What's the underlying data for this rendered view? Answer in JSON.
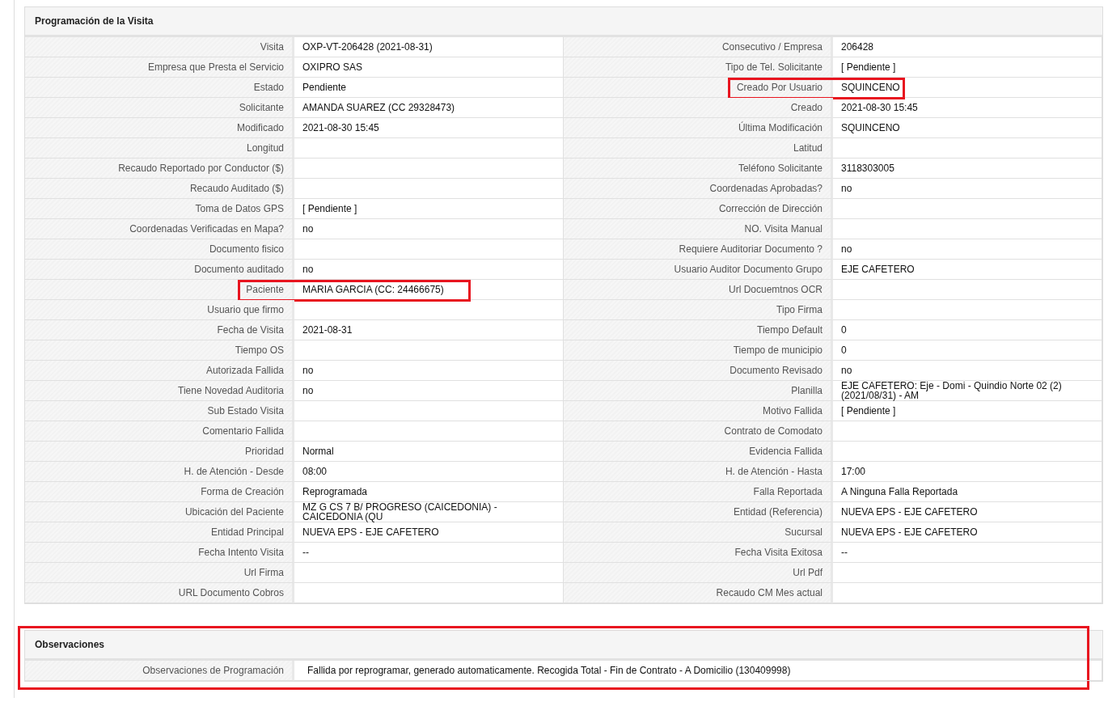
{
  "visit_panel": {
    "title": "Programación de la Visita",
    "rows": [
      {
        "left": {
          "label": "Visita",
          "value": "OXP-VT-206428 (2021-08-31)",
          "highlighted": false
        },
        "right": {
          "label": "Consecutivo / Empresa",
          "value": "206428",
          "highlighted": false
        }
      },
      {
        "left": {
          "label": "Empresa que Presta el Servicio",
          "value": "OXIPRO SAS",
          "highlighted": false
        },
        "right": {
          "label": "Tipo de Tel. Solicitante",
          "value": "[ Pendiente ]",
          "highlighted": false
        }
      },
      {
        "left": {
          "label": "Estado",
          "value": "Pendiente",
          "highlighted": false
        },
        "right": {
          "label": "Creado Por Usuario",
          "value": "SQUINCENO",
          "highlighted": true
        }
      },
      {
        "left": {
          "label": "Solicitante",
          "value": "AMANDA SUAREZ (CC 29328473)",
          "highlighted": false
        },
        "right": {
          "label": "Creado",
          "value": "2021-08-30 15:45",
          "highlighted": false
        }
      },
      {
        "left": {
          "label": "Modificado",
          "value": "2021-08-30 15:45",
          "highlighted": false
        },
        "right": {
          "label": "Última Modificación",
          "value": "SQUINCENO",
          "highlighted": false
        }
      },
      {
        "left": {
          "label": "Longitud",
          "highlighted": false
        },
        "right": {
          "label": "Latitud",
          "highlighted": false
        }
      },
      {
        "left": {
          "label": "Recaudo Reportado por Conductor ($)",
          "highlighted": false
        },
        "right": {
          "label": "Teléfono Solicitante",
          "value": "3118303005",
          "highlighted": false
        }
      },
      {
        "left": {
          "label": "Recaudo Auditado ($)",
          "highlighted": false
        },
        "right": {
          "label": "Coordenadas Aprobadas?",
          "value": "no",
          "highlighted": false
        }
      },
      {
        "left": {
          "label": "Toma de Datos GPS",
          "value": "[ Pendiente ]",
          "highlighted": false
        },
        "right": {
          "label": "Corrección de Dirección",
          "highlighted": false
        }
      },
      {
        "left": {
          "label": "Coordenadas Verificadas en Mapa?",
          "value": "no",
          "highlighted": false
        },
        "right": {
          "label": "NO. Visita Manual",
          "highlighted": false
        }
      },
      {
        "left": {
          "label": "Documento fisico",
          "highlighted": false
        },
        "right": {
          "label": "Requiere Auditoriar Documento ?",
          "value": "no",
          "highlighted": false
        }
      },
      {
        "left": {
          "label": "Documento auditado",
          "value": "no",
          "highlighted": false
        },
        "right": {
          "label": "Usuario Auditor Documento Grupo",
          "value": "EJE CAFETERO",
          "highlighted": false
        }
      },
      {
        "left": {
          "label": "Paciente",
          "value": "MARIA GARCIA (CC: 24466675)",
          "highlighted": true
        },
        "right": {
          "label": "Url Docuemtnos OCR",
          "highlighted": false
        }
      },
      {
        "left": {
          "label": "Usuario que firmo",
          "highlighted": false
        },
        "right": {
          "label": "Tipo Firma",
          "highlighted": false
        }
      },
      {
        "left": {
          "label": "Fecha de Visita",
          "value": "2021-08-31",
          "highlighted": false
        },
        "right": {
          "label": "Tiempo Default",
          "value": "0",
          "highlighted": false
        }
      },
      {
        "left": {
          "label": "Tiempo OS",
          "highlighted": false
        },
        "right": {
          "label": "Tiempo de municipio",
          "value": "0",
          "highlighted": false
        }
      },
      {
        "left": {
          "label": "Autorizada Fallida",
          "value": "no",
          "highlighted": false
        },
        "right": {
          "label": "Documento Revisado",
          "value": "no",
          "highlighted": false
        }
      },
      {
        "left": {
          "label": "Tiene Novedad Auditoria",
          "value": "no",
          "highlighted": false
        },
        "right": {
          "label": "Planilla",
          "value": "EJE CAFETERO: Eje - Domi - Quindio Norte 02 (2) (2021/08/31) - AM",
          "highlighted": false
        }
      },
      {
        "left": {
          "label": "Sub Estado Visita",
          "highlighted": false
        },
        "right": {
          "label": "Motivo Fallida",
          "value": "[ Pendiente ]",
          "highlighted": false
        }
      },
      {
        "left": {
          "label": "Comentario Fallida",
          "highlighted": false
        },
        "right": {
          "label": "Contrato de Comodato",
          "highlighted": false
        }
      },
      {
        "left": {
          "label": "Prioridad",
          "value": "Normal",
          "highlighted": false
        },
        "right": {
          "label": "Evidencia Fallida",
          "highlighted": false
        }
      },
      {
        "left": {
          "label": "H. de Atención - Desde",
          "value": "08:00",
          "highlighted": false
        },
        "right": {
          "label": "H. de Atención - Hasta",
          "value": "17:00",
          "highlighted": false
        }
      },
      {
        "left": {
          "label": "Forma de Creación",
          "value": "Reprogramada",
          "highlighted": false
        },
        "right": {
          "label": "Falla Reportada",
          "value": "A Ninguna Falla Reportada",
          "highlighted": false
        }
      },
      {
        "left": {
          "label": "Ubicación del Paciente",
          "value": "MZ G CS 7 B/ PROGRESO (CAICEDONIA) - CAICEDONIA (QU",
          "highlighted": false
        },
        "right": {
          "label": "Entidad (Referencia)",
          "value": "NUEVA EPS - EJE CAFETERO",
          "highlighted": false
        }
      },
      {
        "left": {
          "label": "Entidad Principal",
          "value": "NUEVA EPS - EJE CAFETERO",
          "highlighted": false
        },
        "right": {
          "label": "Sucursal",
          "value": "NUEVA EPS - EJE CAFETERO",
          "highlighted": false
        }
      },
      {
        "left": {
          "label": "Fecha Intento Visita",
          "value": "--",
          "highlighted": false
        },
        "right": {
          "label": "Fecha Visita Exitosa",
          "value": "--",
          "highlighted": false
        }
      },
      {
        "left": {
          "label": "Url Firma",
          "highlighted": false
        },
        "right": {
          "label": "Url Pdf",
          "highlighted": false
        }
      },
      {
        "left": {
          "label": "URL Documento Cobros",
          "highlighted": false
        },
        "right": {
          "label": "Recaudo CM Mes actual",
          "highlighted": false
        }
      }
    ]
  },
  "observations_panel": {
    "title": "Observaciones",
    "highlighted": true,
    "label": "Observaciones de Programación",
    "value": "Fallida por reprogramar, generado automaticamente. Recogida Total - Fin de Contrato - A Domicilio (130409998)"
  }
}
